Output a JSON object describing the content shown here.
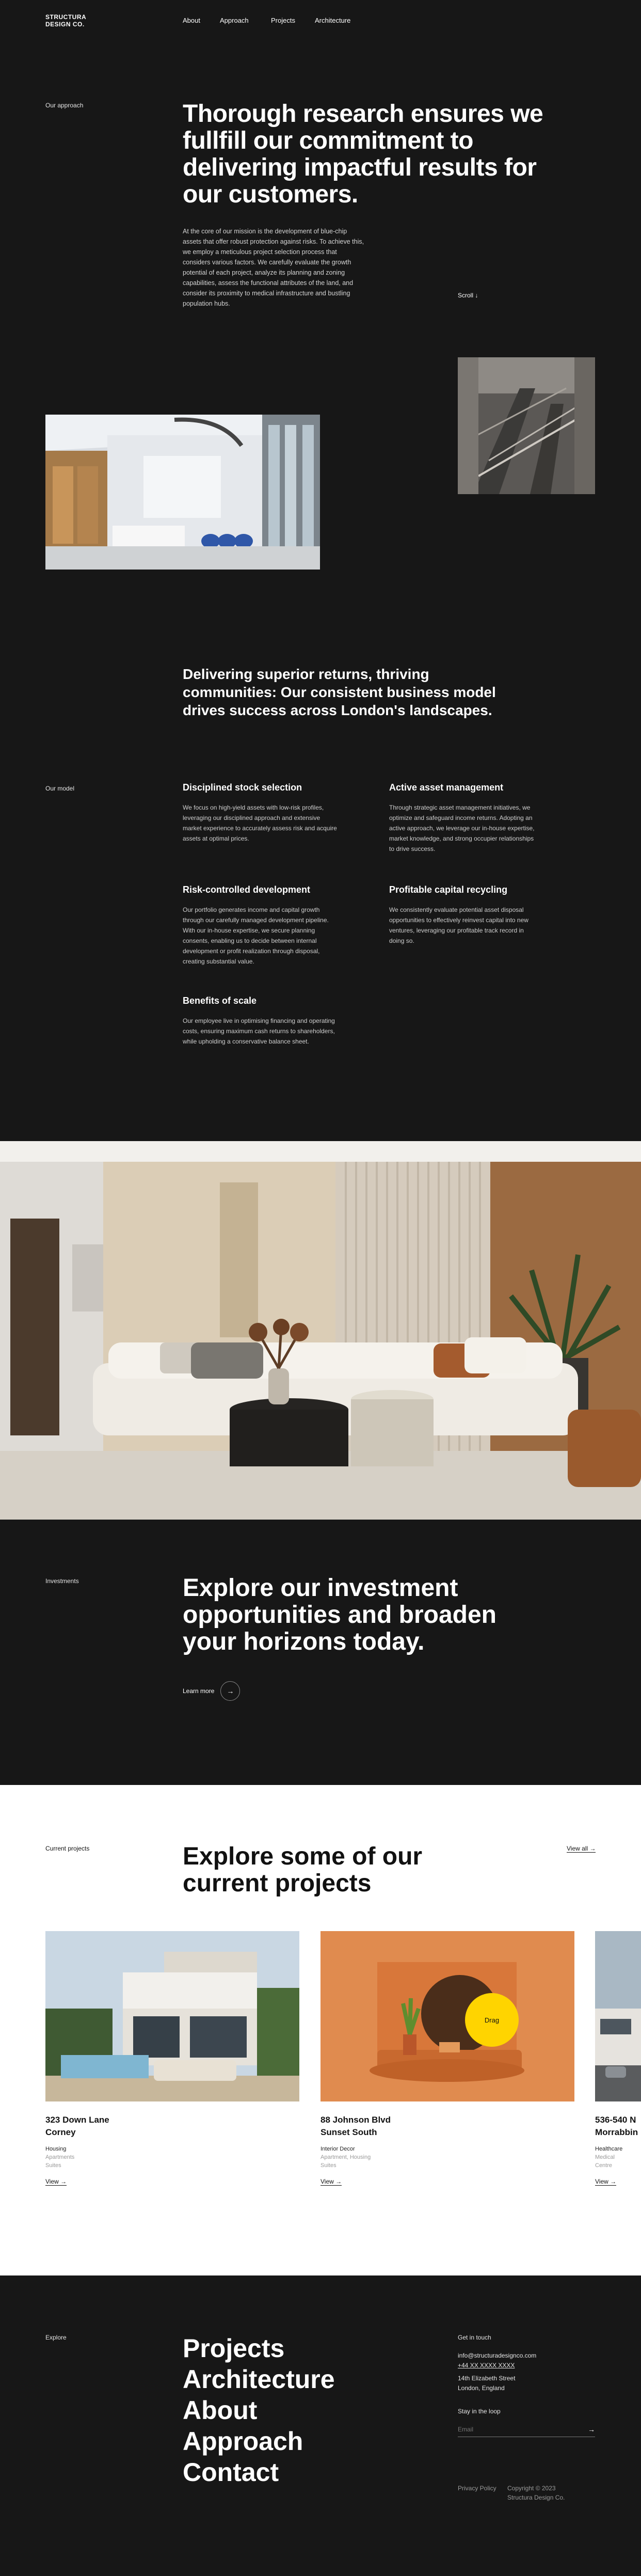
{
  "nav": {
    "logo_line1": "STRUCTURA",
    "logo_line2": "DESIGN CO.",
    "links": [
      "About",
      "Approach",
      "Projects",
      "Architecture"
    ]
  },
  "intro": {
    "label": "Our approach",
    "title": "Thorough research ensures we fullfill our commitment to delivering impactful results for our customers.",
    "body": "At the core of our mission is the development of blue-chip assets that offer robust protection against risks. To achieve this, we employ a meticulous project selection process that considers various factors. We carefully evaluate the growth potential of each project, analyze its planning and zoning capabilities, assess the functional attributes of the land, and consider its proximity to medical infrastructure and bustling population hubs.",
    "scroll_label": "Scroll",
    "scroll_arrow": "↓"
  },
  "model": {
    "headline": "Delivering superior returns, thriving communities: Our consistent business model drives success across London's landscapes.",
    "label": "Our model",
    "features": [
      {
        "title": "Disciplined stock selection",
        "text": "We focus on high-yield assets with low-risk profiles, leveraging our disciplined approach and extensive market experience to accurately assess risk and acquire assets at optimal prices."
      },
      {
        "title": "Active asset management",
        "text": "Through strategic asset management initiatives, we optimize and safeguard income returns. Adopting an active approach, we leverage our in-house expertise, market knowledge, and strong occupier relationships to drive success."
      },
      {
        "title": "Risk-controlled development",
        "text": "Our portfolio generates income and capital growth through our carefully managed development pipeline. With our in-house expertise, we secure planning consents, enabling us to decide between internal development or profit realization through disposal, creating substantial value."
      },
      {
        "title": "Profitable capital recycling",
        "text": "We consistently evaluate potential asset disposal opportunities to effectively reinvest capital into new ventures, leveraging our profitable track record in doing so."
      },
      {
        "title": "Benefits of scale",
        "text": "Our employee live in optimising financing and operating costs, ensuring maximum cash returns to shareholders, while upholding a conservative balance sheet."
      }
    ]
  },
  "investments": {
    "label": "Investments",
    "title": "Explore our investment opportunities and broaden your horizons today.",
    "cta": "Learn more",
    "cta_icon": "→"
  },
  "projects": {
    "label": "Current projects",
    "title": "Explore some of our current projects",
    "view_all": "View all",
    "drag": "Drag",
    "cards": [
      {
        "title_line1": "323 Down Lane",
        "title_line2": "Corney",
        "tag": "Housing",
        "sub1": "Apartments",
        "sub2": "Suites",
        "link": "View"
      },
      {
        "title_line1": "88 Johnson Blvd",
        "title_line2": "Sunset South",
        "tag": "Interior Decor",
        "sub1": "Apartment, Housing",
        "sub2": "Suites",
        "link": "View"
      },
      {
        "title_line1": "536-540 N",
        "title_line2": "Morrabbin",
        "tag": "Healthcare",
        "sub1": "Medical",
        "sub2": "Centre",
        "link": "View"
      }
    ]
  },
  "footer": {
    "label": "Explore",
    "links": [
      "Projects",
      "Architecture",
      "About",
      "Approach",
      "Contact"
    ],
    "contact_label": "Get in touch",
    "email": "info@structuradesignco.com",
    "phone": "+44 XX XXXX XXXX",
    "address1": "14th Elizabeth Street",
    "address2": "London, England",
    "newsletter_label": "Stay in the loop",
    "email_placeholder": "Email",
    "submit_icon": "→",
    "privacy": "Privacy Policy",
    "copyright1": "Copyright © 2023",
    "copyright2": "Structura Design Co."
  },
  "colors": {
    "background": "#171717",
    "text": "#ffffff",
    "accent_drag": "#ffd400",
    "light_section": "#ffffff"
  }
}
